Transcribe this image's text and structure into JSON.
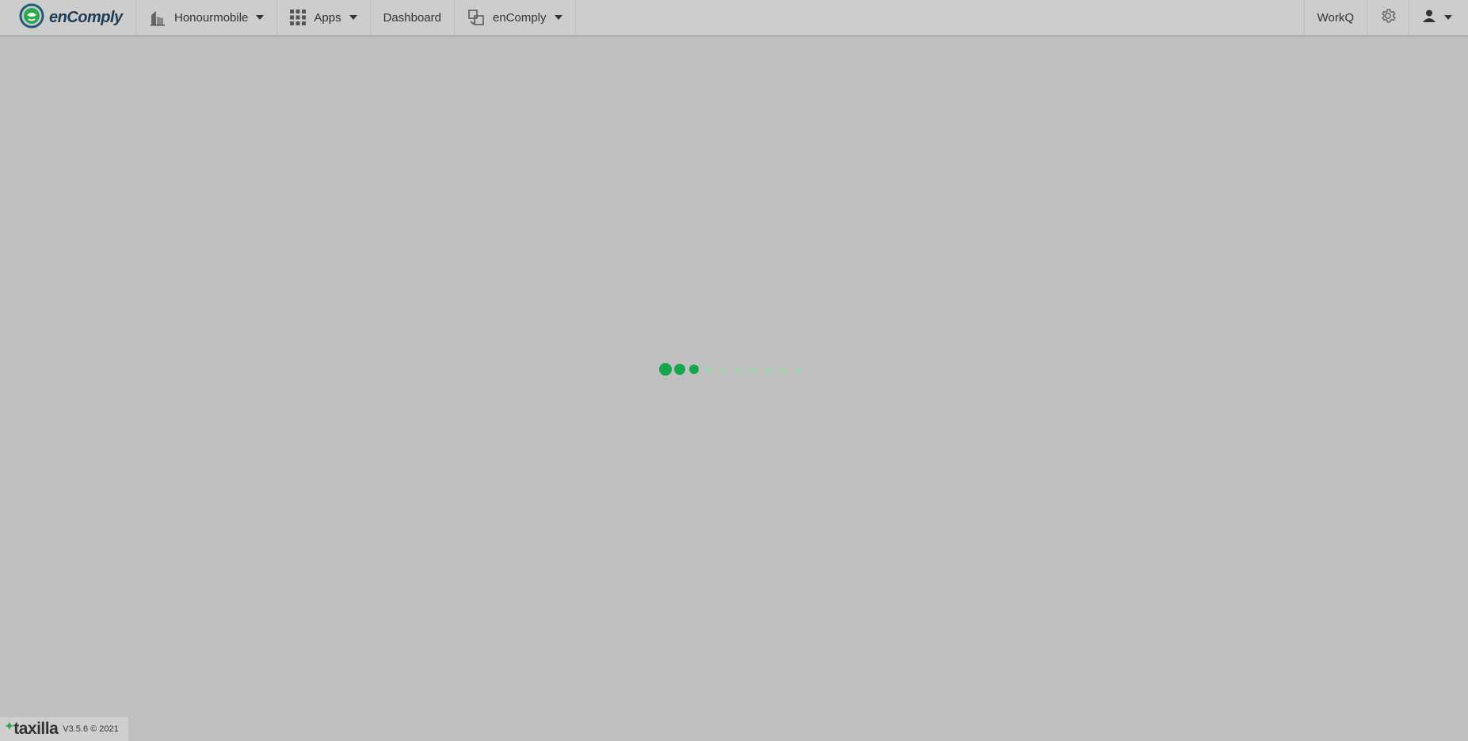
{
  "header": {
    "brand": "enComply",
    "org_selector": "Honourmobile",
    "apps_label": "Apps",
    "dashboard_label": "Dashboard",
    "app_switcher": "enComply",
    "workq_label": "WorkQ"
  },
  "loader": {
    "dots_active": 3,
    "dots_total": 10,
    "active_color": "#12a84a",
    "inactive_color": "#a9cfb3"
  },
  "footer": {
    "vendor": "taxilla",
    "version": "V3.5.6 © 2021"
  },
  "icons": {
    "brand": "encomply-logo-icon",
    "org": "building-icon",
    "apps": "grid-icon",
    "switcher": "app-switch-icon",
    "settings": "gear-icon",
    "user": "user-icon"
  }
}
